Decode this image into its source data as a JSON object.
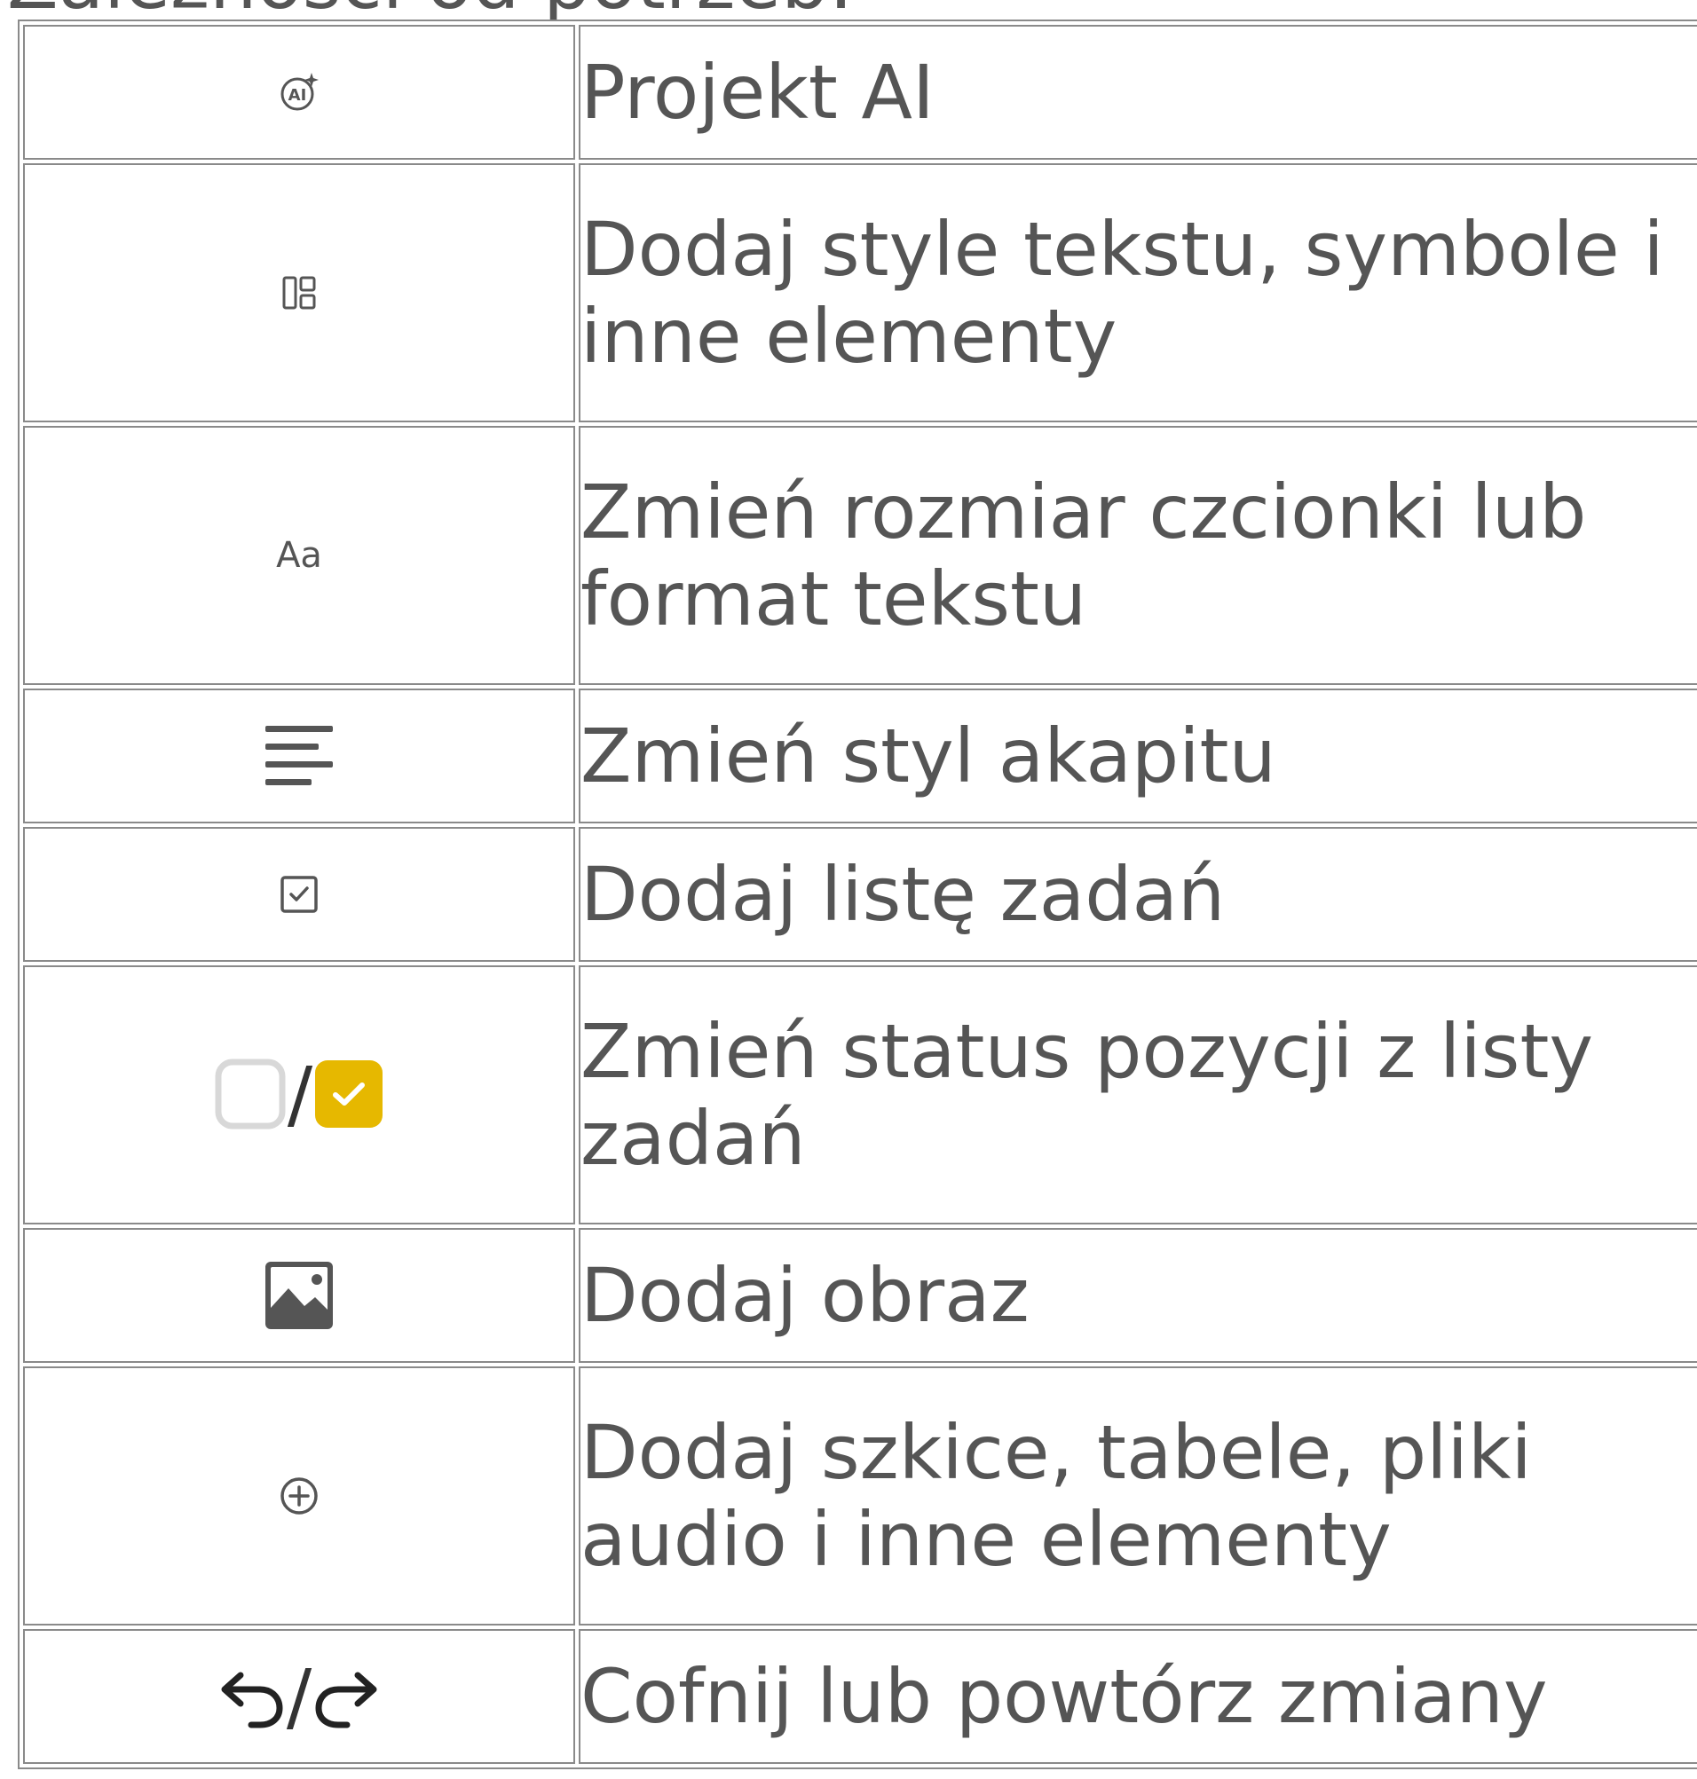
{
  "heading": "Zależności od potrzeb:",
  "rows": [
    {
      "icon": "ai-sparkle-icon",
      "desc": "Projekt AI"
    },
    {
      "icon": "layout-elements-icon",
      "desc": "Dodaj style tekstu, symbole i inne elementy"
    },
    {
      "icon": "text-size-icon",
      "icon_text": "Aa",
      "desc": "Zmień rozmiar czcionki lub format tekstu"
    },
    {
      "icon": "paragraph-align-icon",
      "desc": "Zmień styl akapitu"
    },
    {
      "icon": "checklist-icon",
      "desc": "Dodaj listę zadań"
    },
    {
      "icon": "checkbox-unchecked-checked-icon",
      "separator": "/",
      "desc": "Zmień status pozycji z listy zadań"
    },
    {
      "icon": "image-icon",
      "desc": "Dodaj obraz"
    },
    {
      "icon": "add-circle-icon",
      "desc": "Dodaj szkice, tabele, pliki audio i inne elementy"
    },
    {
      "icon": "undo-redo-icon",
      "separator": "/",
      "desc": "Cofnij lub powtórz zmiany"
    }
  ],
  "colors": {
    "text": "#555555",
    "border": "#8a8a8a",
    "checkbox_checked": "#E6B800",
    "checkbox_unchecked_border": "#d8d8d8"
  }
}
